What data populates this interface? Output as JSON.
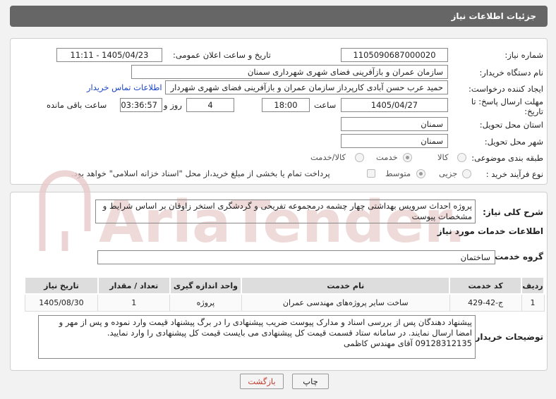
{
  "header": {
    "title": "جزئیات اطلاعات نیاز"
  },
  "fields": {
    "need_number_label": "شماره نیاز:",
    "need_number": "1105090687000020",
    "announce_label": "تاریخ و ساعت اعلان عمومی:",
    "announce_value": "1405/04/23 - 11:11",
    "buyer_org_label": "نام دستگاه خریدار:",
    "buyer_org": "سازمان عمران و بازآفرینی فضای شهری شهرداری سمنان",
    "creator_label": "ایجاد کننده درخواست:",
    "creator": "حمید عرب حسن آبادی کارپرداز سازمان عمران و بازآفرینی فضای شهری شهردار",
    "contact_link": "اطلاعات تماس خریدار",
    "deadline_label_1": "مهلت ارسال پاسخ: تا",
    "deadline_label_2": "تاریخ:",
    "deadline_date": "1405/04/27",
    "time_label": "ساعت",
    "deadline_time": "18:00",
    "days_value": "4",
    "days_label": "روز و",
    "remaining_time": "03:36:57",
    "remaining_label": "ساعت باقی مانده",
    "province_label": "استان محل تحویل:",
    "province": "سمنان",
    "city_label": "شهر محل تحویل:",
    "city": "سمنان",
    "category_label": "طبقه بندی موضوعی:",
    "category_options": [
      "کالا",
      "خدمت",
      "کالا/خدمت"
    ],
    "process_label": "نوع فرآیند خرید :",
    "process_options": [
      "جزیی",
      "متوسط"
    ],
    "payment_note": "پرداخت تمام یا بخشی از مبلغ خرید،از محل \"اسناد خزانه اسلامی\" خواهد بود."
  },
  "description": {
    "label": "شرح کلی نیاز:",
    "text": "پروژه احداث سرویس بهداشتی چهار چشمه درمجموعه تفریحی و گردشگری  استخر زاوقان  بر اساس شرایط و مشخصات پیوست"
  },
  "services": {
    "section_title": "اطلاعات خدمات مورد نیاز",
    "group_label": "گروه خدمت:",
    "group_value": "ساختمان",
    "columns": [
      "ردیف",
      "کد خدمت",
      "نام خدمت",
      "واحد اندازه گیری",
      "تعداد / مقدار",
      "تاریخ نیاز"
    ],
    "rows": [
      [
        "1",
        "ج-42-429",
        "ساخت سایر پروژه‌های مهندسی عمران",
        "پروژه",
        "1",
        "1405/08/30"
      ]
    ]
  },
  "buyer_notes": {
    "label": "توضیحات خریدار:",
    "line1": "پیشنهاد دهندگان پس از بررسی اسناد و مدارک پیوست ضریب پیشنهادی را در برگ پیشنهاد قیمت وارد نموده و پس از مهر و",
    "line2": "امضا ارسال نمایند. در سامانه ستاد قسمت قیمت کل پیشنهادی می بایست قیمت کل پیشنهادی را وارد نمایید.",
    "line3": "09128312135 آقای مهندس کاظمی"
  },
  "buttons": {
    "print": "چاپ",
    "back": "بازگشت"
  },
  "watermark": {
    "text": "AriaTender.neT"
  },
  "colors": {
    "header_bg": "#666666",
    "link": "#1a44c8",
    "back_button_text": "#c0392b"
  }
}
